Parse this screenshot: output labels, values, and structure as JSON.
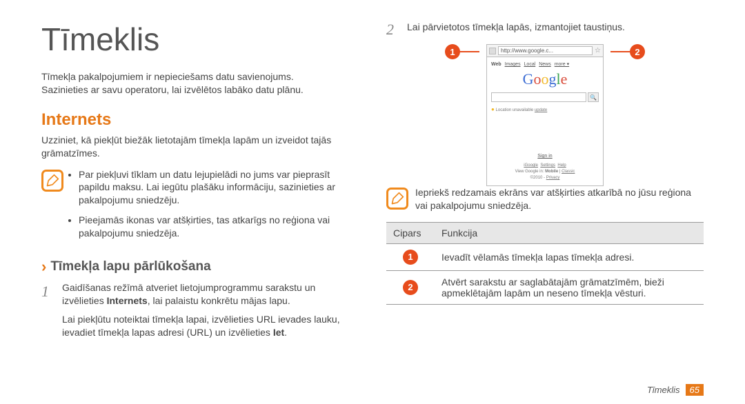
{
  "h1": "Tīmeklis",
  "intro_lines": [
    "Tīmekļa pakalpojumiem ir nepieciešams datu savienojums.",
    "Sazinieties ar savu operatoru, lai izvēlētos labāko datu plānu."
  ],
  "h2": "Internets",
  "h2_sub": "Uzziniet, kā piekļūt biežāk lietotajām tīmekļa lapām un izveidot tajās grāmatzīmes.",
  "bullets": [
    "Par piekļuvi tīklam un datu lejupielādi no jums var pieprasīt papildu maksu. Lai iegūtu plašāku informāciju, sazinieties ar pakalpojumu sniedzēju.",
    "Pieejamās ikonas var atšķirties, tas atkarīgs no reģiona vai pakalpojumu sniedzēja."
  ],
  "chevron": "›",
  "h3": "Tīmekļa lapu pārlūkošana",
  "step1": {
    "num": "1",
    "body_prefix": "Gaidīšanas režīmā atveriet lietojumprogrammu sarakstu un izvēlieties ",
    "bold": "Internets",
    "body_suffix": ", lai palaistu konkrētu mājas lapu.",
    "para2_prefix": "Lai piekļūtu noteiktai tīmekļa lapai, izvēlieties URL ievades lauku, ievadiet tīmekļa lapas adresi (URL) un izvēlieties ",
    "para2_bold": "Iet",
    "para2_suffix": "."
  },
  "step2": {
    "num": "2",
    "body": "Lai pārvietotos tīmekļa lapās, izmantojiet taustiņus."
  },
  "callouts": {
    "left": "1",
    "right": "2"
  },
  "mock": {
    "url": "http://www.google.c...",
    "star": "☆",
    "tabs_bold": "Web",
    "tabs": [
      "Images",
      "Local",
      "News",
      "more ▾"
    ],
    "search_btn": "🔍",
    "loc_dot": "●",
    "loc_text": "Location unavailable ",
    "loc_link": "update",
    "signin": "Sign in",
    "below_line1_links": [
      "iGoogle",
      "Settings",
      "Help"
    ],
    "below_line2_prefix": "View Google in: ",
    "below_line2_bold": "Mobile",
    "below_line2_sep": " | ",
    "below_line2_link": "Classic",
    "below_line3_prefix": "©2010 - ",
    "below_line3_link": "Privacy"
  },
  "note2": "Iepriekš redzamais ekrāns var atšķirties atkarībā no jūsu reģiona vai pakalpojumu sniedzēja.",
  "table": {
    "headers": [
      "Cipars",
      "Funkcija"
    ],
    "rows": [
      {
        "num": "1",
        "desc": "Ievadīt vēlamās tīmekļa lapas tīmekļa adresi."
      },
      {
        "num": "2",
        "desc": "Atvērt sarakstu ar saglabātajām grāmatzīmēm, bieži apmeklētajām lapām un neseno tīmekļa vēsturi."
      }
    ]
  },
  "footer": {
    "section": "Tīmeklis",
    "page": "65"
  }
}
